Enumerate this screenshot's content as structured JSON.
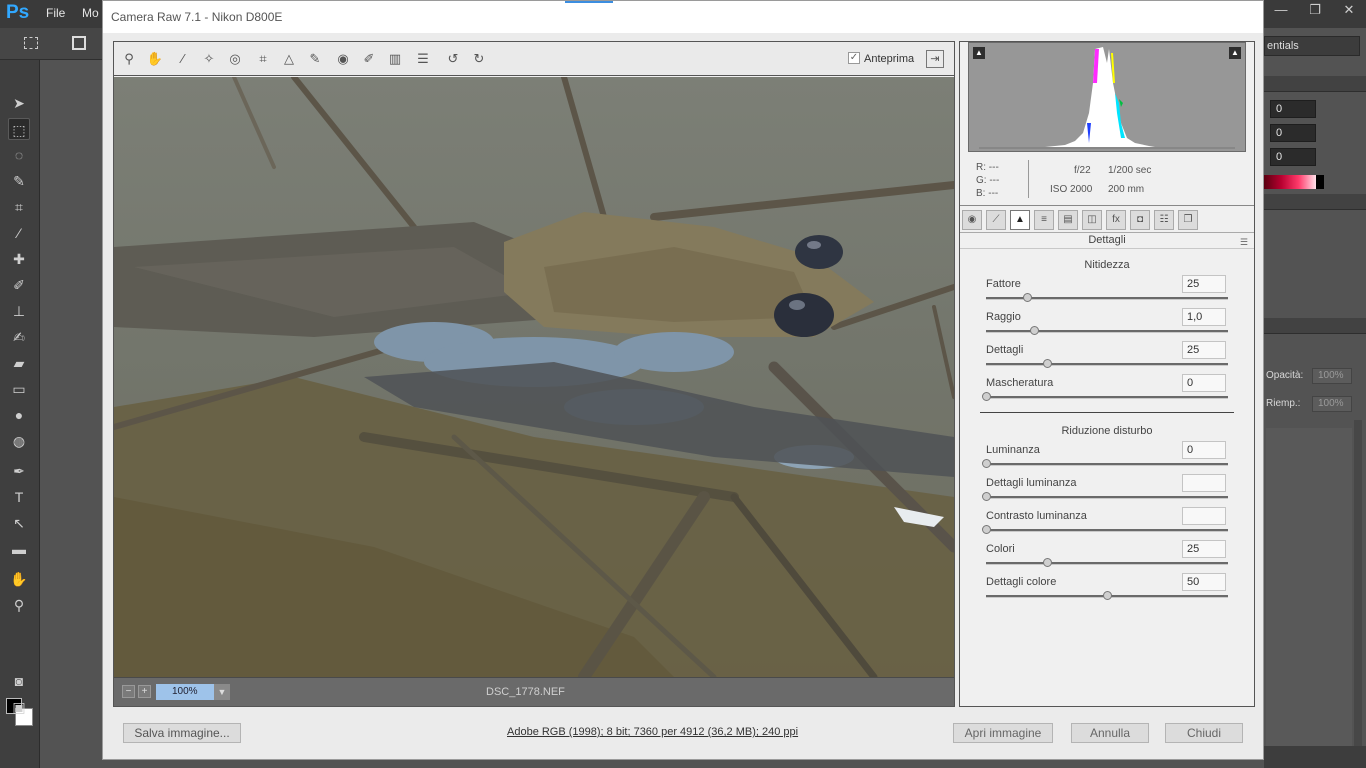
{
  "ps": {
    "logo": "Ps",
    "menus": [
      "File",
      "Mo"
    ],
    "window_controls": [
      "—",
      "❐",
      "✕"
    ],
    "workspace": "entials",
    "color_values": [
      "0",
      "0",
      "0"
    ],
    "layers": {
      "opacity_label": "Opacità:",
      "opacity_value": "100%",
      "fill_label": "Riemp.:",
      "fill_value": "100%"
    }
  },
  "acr": {
    "title": "Camera Raw 7.1  -  Nikon D800E",
    "preview_label": "Anteprima",
    "zoom": "100%",
    "filename": "DSC_1778.NEF",
    "info": {
      "r_label": "R:",
      "g_label": "G:",
      "b_label": "B:",
      "r_value": "---",
      "g_value": "---",
      "b_value": "---",
      "aperture": "f/22",
      "shutter": "1/200 sec",
      "iso": "ISO 2000",
      "focal": "200 mm"
    },
    "panel_title": "Dettagli",
    "sharpening": {
      "title": "Nitidezza",
      "sliders": [
        {
          "label": "Fattore",
          "value": "25",
          "position": 0.17
        },
        {
          "label": "Raggio",
          "value": "1,0",
          "position": 0.2
        },
        {
          "label": "Dettagli",
          "value": "25",
          "position": 0.25
        },
        {
          "label": "Mascheratura",
          "value": "0",
          "position": 0.0
        }
      ]
    },
    "noise": {
      "title": "Riduzione disturbo",
      "sliders": [
        {
          "label": "Luminanza",
          "value": "0",
          "position": 0.0
        },
        {
          "label": "Dettagli luminanza",
          "value": "",
          "position": 0.0
        },
        {
          "label": "Contrasto luminanza",
          "value": "",
          "position": 0.0
        },
        {
          "label": "Colori",
          "value": "25",
          "position": 0.25
        },
        {
          "label": "Dettagli colore",
          "value": "50",
          "position": 0.5
        }
      ]
    },
    "footer": {
      "save": "Salva immagine...",
      "workflow": "Adobe RGB (1998); 8 bit; 7360 per 4912 (36,2 MB); 240 ppi",
      "open": "Apri immagine",
      "cancel": "Annulla",
      "done": "Chiudi"
    }
  }
}
